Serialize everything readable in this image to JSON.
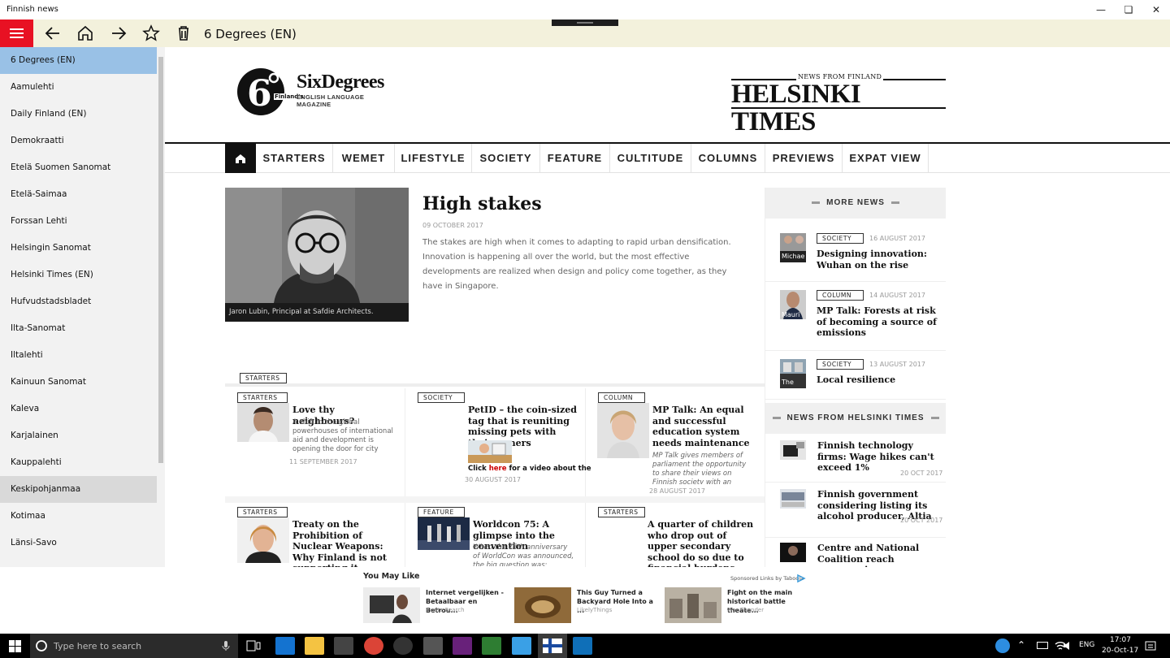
{
  "window": {
    "title": "Finnish news"
  },
  "toolbar": {
    "title": "6 Degrees (EN)"
  },
  "sidebar": {
    "items": [
      "6 Degrees (EN)",
      "Aamulehti",
      "Daily Finland (EN)",
      "Demokraatti",
      "Etelä Suomen Sanomat",
      "Etelä-Saimaa",
      "Forssan Lehti",
      "Helsingin Sanomat",
      "Helsinki Times (EN)",
      "Hufvudstadsbladet",
      "Ilta-Sanomat",
      "Iltalehti",
      "Kainuun Sanomat",
      "Kaleva",
      "Karjalainen",
      "Kauppalehti",
      "Keskipohjanmaa",
      "Kotimaa",
      "Länsi-Savo"
    ],
    "selected": "6 Degrees (EN)",
    "hovered": "Keskipohjanmaa"
  },
  "site": {
    "sixdegrees_name": "SixDegrees",
    "sixdegrees_tagline": "ENGLISH LANGUAGE MAGAZINE",
    "sixdegrees_prefix": "Finland's",
    "ht_small": "NEWS FROM FINLAND",
    "ht_big": "HELSINKI TIMES",
    "nav": [
      "STARTERS",
      "WEMET",
      "LIFESTYLE",
      "SOCIETY",
      "FEATURE",
      "CULTITUDE",
      "COLUMNS",
      "PREVIEWS",
      "EXPAT VIEW"
    ]
  },
  "hero": {
    "title": "High stakes",
    "date": "09 OCTOBER 2017",
    "text": "The stakes are high when it comes to adapting to rapid urban densification. Innovation is happening all over the world, but the most effective developments are realized when design and policy come together, as they have in Singapore.",
    "caption": "Jaron Lubin, Principal at Safdie Architects."
  },
  "section_tag": "STARTERS",
  "cards": [
    {
      "tag": "STARTERS",
      "title": "Love thy neighbours?",
      "text": "A shift in the global powerhouses of international aid and development is opening the door for city",
      "date": "11 SEPTEMBER 2017"
    },
    {
      "tag": "SOCIETY",
      "title": "PetID – the coin-sized tag that is reuniting missing pets with their owners",
      "text_pre": "Click ",
      "text_link": "here",
      "text_post": " for a video about the",
      "date": "30 AUGUST 2017"
    },
    {
      "tag": "COLUMN",
      "title": "MP Talk: An equal and successful education system needs maintenance",
      "text": "MP Talk gives members of parliament the opportunity to share their views on Finnish society with an international",
      "date": "28 AUGUST 2017"
    },
    {
      "tag": "STARTERS",
      "title": "Treaty on the Prohibition of Nuclear Weapons: Why Finland is not supporting it"
    },
    {
      "tag": "FEATURE",
      "title": "Worldcon 75: A glimpse into the convention",
      "text": "When the 75th anniversary of WorldCon was announced, the big question was: \"Where will it"
    },
    {
      "tag": "STARTERS",
      "title": "A quarter of children who drop out of upper secondary school do so due to financial burdens"
    }
  ],
  "more_news": {
    "heading": "MORE NEWS",
    "items": [
      {
        "tag": "SOCIETY",
        "date": "16 AUGUST 2017",
        "title": "Designing innovation: Wuhan on the rise",
        "thumb_label": "Michae"
      },
      {
        "tag": "COLUMN",
        "date": "14 AUGUST 2017",
        "title": "MP Talk: Forests at risk of becoming a source of emissions",
        "thumb_label": "Mauri"
      },
      {
        "tag": "SOCIETY",
        "date": "13 AUGUST 2017",
        "title": "Local resilience",
        "thumb_label": "The"
      }
    ]
  },
  "ht_news": {
    "heading": "NEWS FROM HELSINKI TIMES",
    "items": [
      {
        "title": "Finnish technology firms: Wage hikes can't exceed 1%",
        "date": "20 OCT 2017"
      },
      {
        "title": "Finnish government considering listing its alcohol producer, Altia",
        "date": "20 OCT 2017"
      },
      {
        "title": "Centre and National Coalition reach compromise on"
      }
    ]
  },
  "ads": {
    "heading": "You May Like",
    "sponsor": "Sponsored Links by Taboola",
    "items": [
      {
        "title": "Internet vergelijken - Betaalbaar en Betrou...",
        "source": "Excite Search"
      },
      {
        "title": "This Guy Turned a Backyard Hole Into a ...",
        "source": "LikelyThings"
      },
      {
        "title": "Fight on the main historical battle theate...",
        "source": "War Thunder"
      }
    ]
  },
  "taskbar": {
    "search_placeholder": "Type here to search",
    "lang": "ENG",
    "time": "17:07",
    "date": "20-Oct-17"
  },
  "colors": {
    "accent_red": "#e81123",
    "toolbar_bg": "#f3f1dc",
    "selected": "#99c1e6"
  }
}
